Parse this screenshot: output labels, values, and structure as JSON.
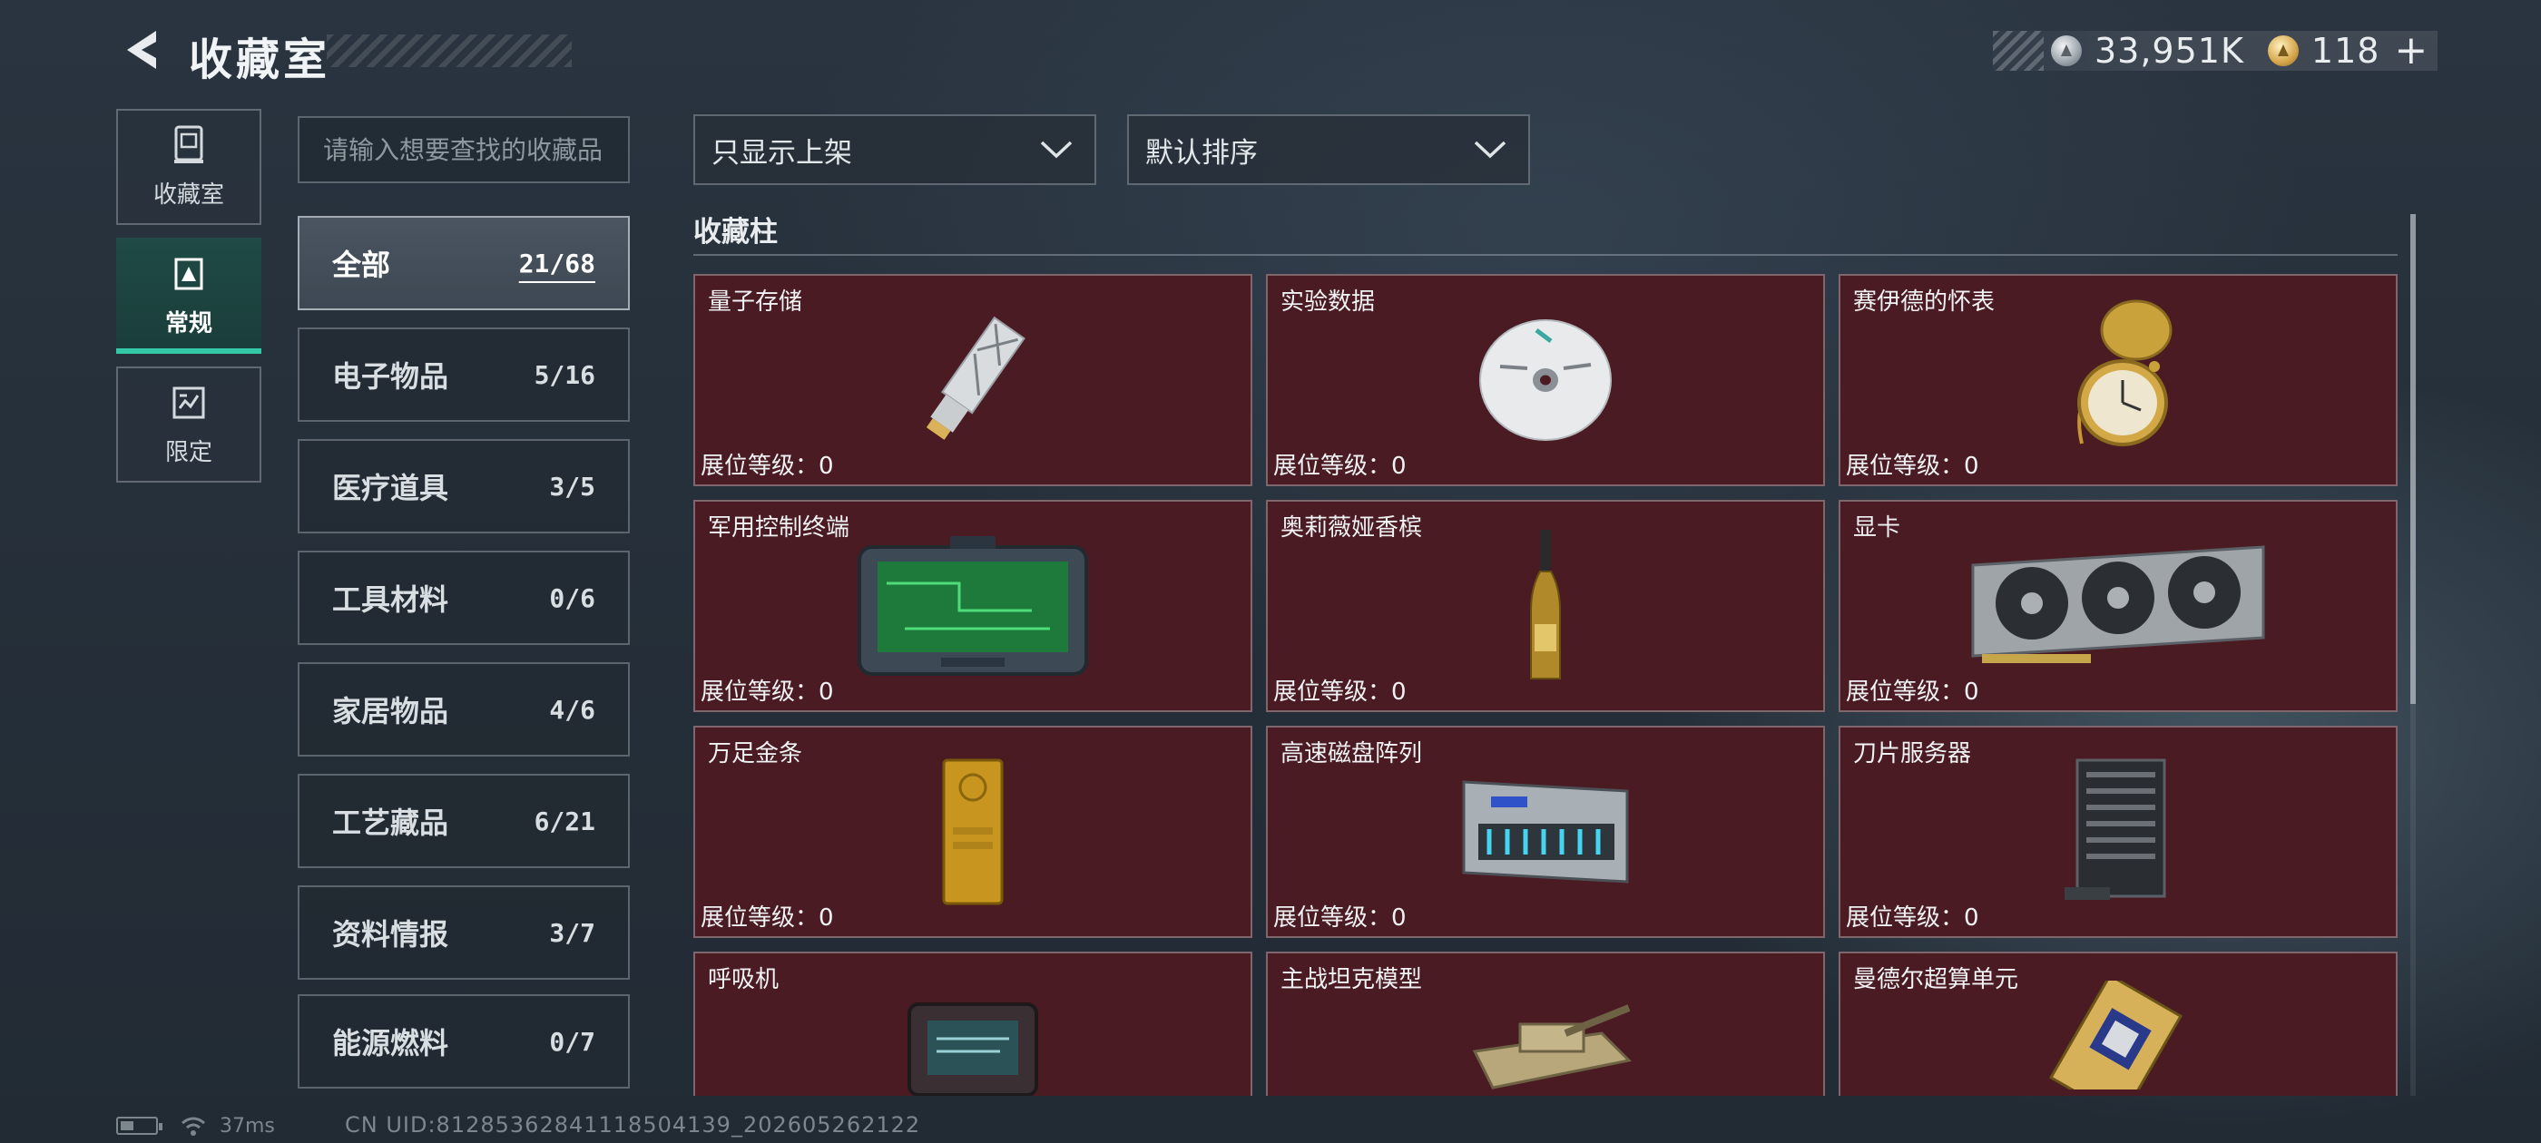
{
  "header": {
    "title": "收藏室",
    "currency_silver": "33,951K",
    "currency_gold": "118"
  },
  "rail": [
    {
      "label": "收藏室",
      "icon": "collection-room-icon"
    },
    {
      "label": "常规",
      "icon": "regular-icon"
    },
    {
      "label": "限定",
      "icon": "limited-icon"
    }
  ],
  "search": {
    "placeholder": "请输入想要查找的收藏品"
  },
  "categories": [
    {
      "name": "全部",
      "count": "21/68"
    },
    {
      "name": "电子物品",
      "count": "5/16"
    },
    {
      "name": "医疗道具",
      "count": "3/5"
    },
    {
      "name": "工具材料",
      "count": "0/6"
    },
    {
      "name": "家居物品",
      "count": "4/6"
    },
    {
      "name": "工艺藏品",
      "count": "6/21"
    },
    {
      "name": "资料情报",
      "count": "3/7"
    },
    {
      "name": "能源燃料",
      "count": "0/7"
    }
  ],
  "filters": {
    "listing": "只显示上架",
    "sort": "默认排序"
  },
  "cabinet": {
    "title": "收藏柱",
    "level_label": "展位等级：",
    "items": [
      {
        "name": "量子存储",
        "level": "0",
        "icon": "quantum-storage-icon"
      },
      {
        "name": "实验数据",
        "level": "0",
        "icon": "disc-icon"
      },
      {
        "name": "赛伊德的怀表",
        "level": "0",
        "icon": "pocket-watch-icon"
      },
      {
        "name": "军用控制终端",
        "level": "0",
        "icon": "control-terminal-icon"
      },
      {
        "name": "奥莉薇娅香槟",
        "level": "0",
        "icon": "champagne-icon"
      },
      {
        "name": "显卡",
        "level": "0",
        "icon": "graphics-card-icon"
      },
      {
        "name": "万足金条",
        "level": "0",
        "icon": "gold-bar-icon"
      },
      {
        "name": "高速磁盘阵列",
        "level": "0",
        "icon": "disk-array-icon"
      },
      {
        "name": "刀片服务器",
        "level": "0",
        "icon": "blade-server-icon"
      },
      {
        "name": "呼吸机",
        "level": "",
        "icon": "ventilator-icon"
      },
      {
        "name": "主战坦克模型",
        "level": "",
        "icon": "tank-model-icon"
      },
      {
        "name": "曼德尔超算单元",
        "level": "",
        "icon": "supercomputer-unit-icon"
      }
    ]
  },
  "footer": {
    "ping": "37ms",
    "uid": "CN UID:81285362841118504139_202605262122"
  }
}
